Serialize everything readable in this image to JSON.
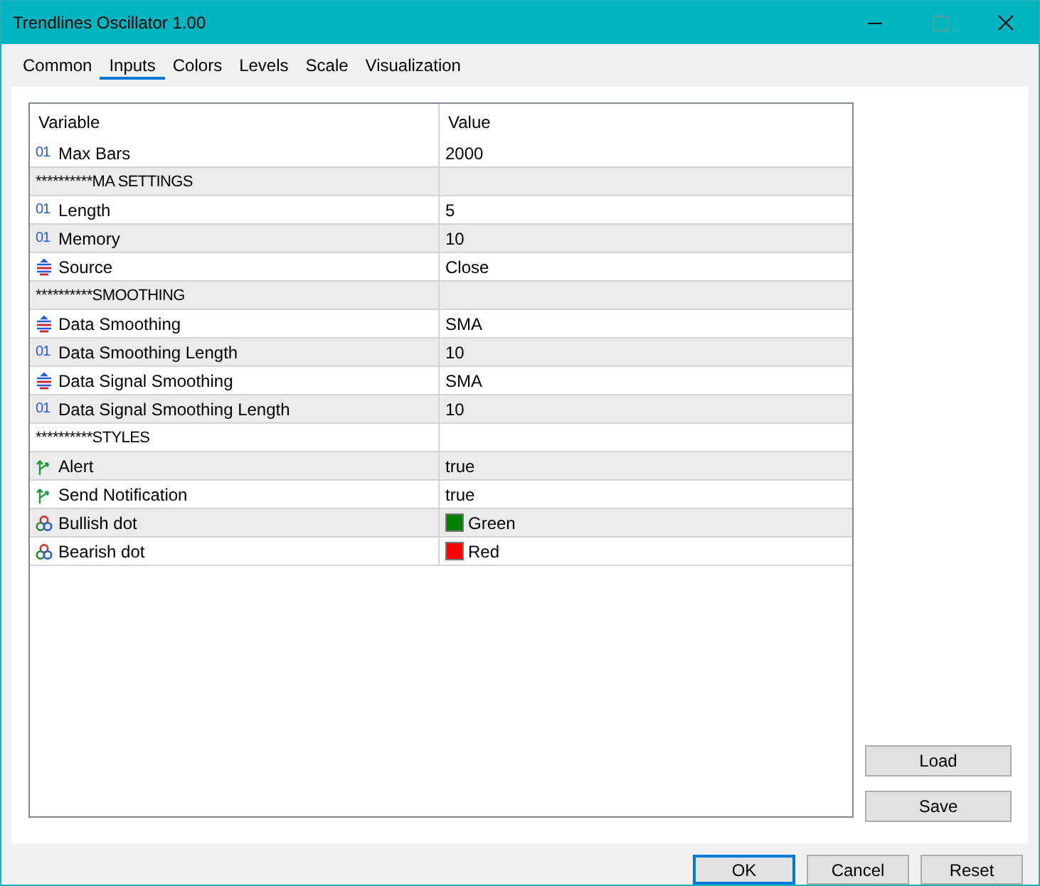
{
  "window": {
    "title": "Trendlines Oscillator 1.00"
  },
  "tabs": [
    {
      "label": "Common",
      "selected": false
    },
    {
      "label": "Inputs",
      "selected": true
    },
    {
      "label": "Colors",
      "selected": false
    },
    {
      "label": "Levels",
      "selected": false
    },
    {
      "label": "Scale",
      "selected": false
    },
    {
      "label": "Visualization",
      "selected": false
    }
  ],
  "table": {
    "columns": [
      "Variable",
      "Value"
    ],
    "rows": [
      {
        "kind": "int",
        "icon": "01",
        "variable": "Max Bars",
        "value": "2000"
      },
      {
        "kind": "header",
        "variable": "**********MA SETTINGS"
      },
      {
        "kind": "int",
        "icon": "01",
        "variable": "Length",
        "value": "5"
      },
      {
        "kind": "int",
        "icon": "01",
        "variable": "Memory",
        "value": "10"
      },
      {
        "kind": "enum",
        "variable": "Source",
        "value": "Close"
      },
      {
        "kind": "header",
        "variable": "**********SMOOTHING"
      },
      {
        "kind": "enum",
        "variable": "Data Smoothing",
        "value": "SMA"
      },
      {
        "kind": "int",
        "icon": "01",
        "variable": "Data Smoothing Length",
        "value": "10"
      },
      {
        "kind": "enum",
        "variable": "Data Signal Smoothing",
        "value": "SMA"
      },
      {
        "kind": "int",
        "icon": "01",
        "variable": "Data Signal Smoothing Length",
        "value": "10"
      },
      {
        "kind": "header",
        "variable": "**********STYLES"
      },
      {
        "kind": "bool",
        "variable": "Alert",
        "value": "true"
      },
      {
        "kind": "bool",
        "variable": "Send Notification",
        "value": "true"
      },
      {
        "kind": "color",
        "variable": "Bullish dot",
        "value": "Green",
        "color": "#008000"
      },
      {
        "kind": "color",
        "variable": "Bearish dot",
        "value": "Red",
        "color": "#ff0000"
      }
    ]
  },
  "side_buttons": [
    "Load",
    "Save"
  ],
  "buttons": [
    {
      "label": "OK",
      "default": true
    },
    {
      "label": "Cancel",
      "default": false
    },
    {
      "label": "Reset",
      "default": false
    }
  ]
}
